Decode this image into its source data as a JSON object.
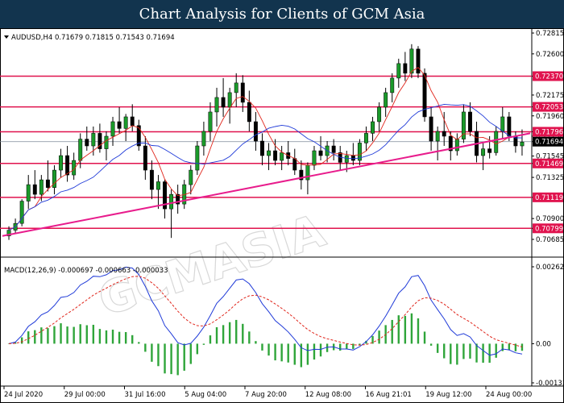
{
  "banner": {
    "title": "Chart Analysis for Clients of GCM Asia"
  },
  "watermark": "GCMASIA",
  "chart_data": {
    "type": "candlestick",
    "price_panel": {
      "symbol_info": "AUDUSD,H4  0.71679 0.71815 0.71543 0.71694",
      "ylim": [
        0.70685,
        0.72815
      ],
      "y_ticks": [
        "0.72815",
        "0.72600",
        "0.72370",
        "0.72175",
        "0.72053",
        "0.71960",
        "0.71796",
        "0.71750",
        "0.71694",
        "0.71545",
        "0.71469",
        "0.71325",
        "0.71119",
        "0.70900",
        "0.70799",
        "0.70685"
      ],
      "current_price": "0.71694",
      "resistance_support_levels": [
        0.7237,
        0.72053,
        0.71796,
        0.71469,
        0.71119,
        0.70799
      ],
      "trendline": {
        "start": [
          0,
          0.7072
        ],
        "end": [
          1,
          0.7178
        ]
      },
      "candles": [
        [
          0.7072,
          0.7082,
          0.7068,
          0.7078
        ],
        [
          0.7078,
          0.709,
          0.7074,
          0.7085
        ],
        [
          0.7085,
          0.711,
          0.7082,
          0.7108
        ],
        [
          0.7108,
          0.7135,
          0.71,
          0.7125
        ],
        [
          0.7125,
          0.714,
          0.711,
          0.7115
        ],
        [
          0.7115,
          0.7135,
          0.7108,
          0.713
        ],
        [
          0.713,
          0.715,
          0.7118,
          0.7122
        ],
        [
          0.7122,
          0.7145,
          0.7115,
          0.714
        ],
        [
          0.714,
          0.7162,
          0.7132,
          0.7155
        ],
        [
          0.7155,
          0.7165,
          0.7128,
          0.7135
        ],
        [
          0.7135,
          0.7158,
          0.713,
          0.715
        ],
        [
          0.715,
          0.7178,
          0.7142,
          0.7172
        ],
        [
          0.7172,
          0.7185,
          0.716,
          0.7165
        ],
        [
          0.7165,
          0.7185,
          0.7155,
          0.7178
        ],
        [
          0.7178,
          0.7188,
          0.7158,
          0.7162
        ],
        [
          0.7162,
          0.718,
          0.715,
          0.7175
        ],
        [
          0.7175,
          0.7195,
          0.7165,
          0.719
        ],
        [
          0.719,
          0.7205,
          0.7178,
          0.7183
        ],
        [
          0.7183,
          0.7198,
          0.717,
          0.7195
        ],
        [
          0.7195,
          0.7208,
          0.718,
          0.7186
        ],
        [
          0.7186,
          0.7192,
          0.716,
          0.7165
        ],
        [
          0.7165,
          0.7175,
          0.713,
          0.714
        ],
        [
          0.714,
          0.715,
          0.711,
          0.712
        ],
        [
          0.712,
          0.7135,
          0.71,
          0.7128
        ],
        [
          0.7128,
          0.713,
          0.709,
          0.71
        ],
        [
          0.71,
          0.712,
          0.707,
          0.7115
        ],
        [
          0.7115,
          0.7125,
          0.7095,
          0.7105
        ],
        [
          0.7105,
          0.713,
          0.71,
          0.7125
        ],
        [
          0.7125,
          0.7145,
          0.7115,
          0.714
        ],
        [
          0.714,
          0.717,
          0.7135,
          0.7165
        ],
        [
          0.7165,
          0.719,
          0.7155,
          0.718
        ],
        [
          0.718,
          0.721,
          0.717,
          0.72
        ],
        [
          0.72,
          0.7225,
          0.7185,
          0.7215
        ],
        [
          0.7215,
          0.7235,
          0.7195,
          0.7205
        ],
        [
          0.7205,
          0.7225,
          0.7188,
          0.722
        ],
        [
          0.722,
          0.724,
          0.7205,
          0.723
        ],
        [
          0.723,
          0.7238,
          0.72,
          0.721
        ],
        [
          0.721,
          0.7222,
          0.718,
          0.719
        ],
        [
          0.719,
          0.72,
          0.716,
          0.717
        ],
        [
          0.717,
          0.7178,
          0.7145,
          0.7155
        ],
        [
          0.7155,
          0.7168,
          0.714,
          0.716
        ],
        [
          0.716,
          0.7172,
          0.7145,
          0.715
        ],
        [
          0.715,
          0.7165,
          0.714,
          0.7158
        ],
        [
          0.7158,
          0.717,
          0.7145,
          0.7152
        ],
        [
          0.7152,
          0.7162,
          0.7135,
          0.714
        ],
        [
          0.714,
          0.715,
          0.712,
          0.713
        ],
        [
          0.713,
          0.7148,
          0.7115,
          0.7145
        ],
        [
          0.7145,
          0.7165,
          0.714,
          0.716
        ],
        [
          0.716,
          0.7175,
          0.715,
          0.7155
        ],
        [
          0.7155,
          0.717,
          0.7148,
          0.7165
        ],
        [
          0.7165,
          0.7172,
          0.715,
          0.7158
        ],
        [
          0.7158,
          0.7165,
          0.714,
          0.7148
        ],
        [
          0.7148,
          0.716,
          0.7138,
          0.7155
        ],
        [
          0.7155,
          0.7168,
          0.7145,
          0.715
        ],
        [
          0.715,
          0.7172,
          0.7145,
          0.7168
        ],
        [
          0.7168,
          0.7185,
          0.716,
          0.7178
        ],
        [
          0.7178,
          0.7195,
          0.717,
          0.719
        ],
        [
          0.719,
          0.721,
          0.718,
          0.7205
        ],
        [
          0.7205,
          0.7225,
          0.7195,
          0.722
        ],
        [
          0.722,
          0.724,
          0.721,
          0.7235
        ],
        [
          0.7235,
          0.7255,
          0.7225,
          0.725
        ],
        [
          0.725,
          0.7262,
          0.7232,
          0.724
        ],
        [
          0.724,
          0.727,
          0.7235,
          0.7265
        ],
        [
          0.7265,
          0.7268,
          0.7235,
          0.724
        ],
        [
          0.724,
          0.7245,
          0.719,
          0.7195
        ],
        [
          0.7195,
          0.7205,
          0.716,
          0.717
        ],
        [
          0.717,
          0.7185,
          0.715,
          0.718
        ],
        [
          0.718,
          0.72,
          0.7165,
          0.7175
        ],
        [
          0.7175,
          0.718,
          0.715,
          0.716
        ],
        [
          0.716,
          0.7178,
          0.7155,
          0.7172
        ],
        [
          0.7172,
          0.7208,
          0.7168,
          0.72
        ],
        [
          0.72,
          0.721,
          0.7175,
          0.718
        ],
        [
          0.718,
          0.719,
          0.7148,
          0.7155
        ],
        [
          0.7155,
          0.7168,
          0.714,
          0.7162
        ],
        [
          0.7162,
          0.7175,
          0.7152,
          0.7158
        ],
        [
          0.7158,
          0.7185,
          0.7155,
          0.718
        ],
        [
          0.718,
          0.7205,
          0.7172,
          0.7195
        ],
        [
          0.7195,
          0.72,
          0.717,
          0.7175
        ],
        [
          0.7175,
          0.718,
          0.7158,
          0.7165
        ],
        [
          0.7165,
          0.7182,
          0.7155,
          0.7169
        ]
      ]
    },
    "x_ticks": [
      "24 Jul 2020",
      "29 Jul 00:00",
      "31 Jul 16:00",
      "5 Aug 04:00",
      "7 Aug 20:00",
      "12 Aug 08:00",
      "16 Aug 21:01",
      "19 Aug 12:00",
      "24 Aug 00:00"
    ],
    "macd_panel": {
      "label": "MACD(12,26,9) -0.000697 -0.000663 -0.000033",
      "ylim": [
        -0.001337,
        0.002626
      ],
      "y_ticks": [
        "0.002626",
        "0.00",
        "-0.001337"
      ],
      "series_colors": {
        "macd": "#1f3ad8",
        "signal": "#e0251b",
        "histogram": "#2fa53a"
      }
    },
    "colors": {
      "bull": "#1a9a2a",
      "bear": "#000000",
      "level": "#e0134e",
      "trend": "#e81c8c",
      "ma_fast": "#e0251b",
      "ma_slow": "#1f3ad8",
      "current_box": "#000000"
    },
    "grid": false
  }
}
